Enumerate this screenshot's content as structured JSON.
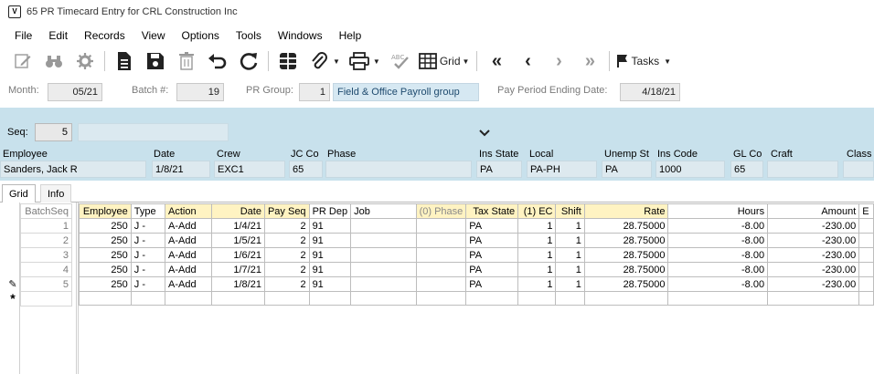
{
  "window": {
    "title": "65 PR Timecard Entry for CRL Construction Inc",
    "icon_glyph": "V"
  },
  "menu": [
    "File",
    "Edit",
    "Records",
    "View",
    "Options",
    "Tools",
    "Windows",
    "Help"
  ],
  "toolbar": {
    "grid_label": "Grid",
    "tasks_label": "Tasks",
    "icons": [
      "edit-icon",
      "binoculars-icon",
      "gear-icon",
      "document-icon",
      "save-icon",
      "trash-icon",
      "undo-icon",
      "refresh-icon",
      "grid-view-icon",
      "attachment-icon",
      "print-icon",
      "spellcheck-icon",
      "first-icon",
      "previous-icon",
      "next-icon",
      "last-icon",
      "flag-icon"
    ]
  },
  "filters": {
    "month_label": "Month:",
    "month_value": "05/21",
    "batch_label": "Batch #:",
    "batch_value": "19",
    "prgroup_label": "PR Group:",
    "prgroup_value": "1",
    "prgroup_desc": "Field & Office Payroll group",
    "ppe_label": "Pay Period Ending Date:",
    "ppe_value": "4/18/21"
  },
  "header": {
    "seq_label": "Seq:",
    "seq_value": "5",
    "fields": [
      {
        "label": "Employee",
        "value": "Sanders, Jack R"
      },
      {
        "label": "Date",
        "value": "1/8/21"
      },
      {
        "label": "Crew",
        "value": "EXC1"
      },
      {
        "label": "JC Co",
        "value": "65"
      },
      {
        "label": "Phase",
        "value": ""
      },
      {
        "label": "Ins State",
        "value": "PA"
      },
      {
        "label": "Local",
        "value": "PA-PH"
      },
      {
        "label": "Unemp St",
        "value": "PA"
      },
      {
        "label": "Ins Code",
        "value": "1000"
      },
      {
        "label": "GL Co",
        "value": "65"
      },
      {
        "label": "Craft",
        "value": ""
      },
      {
        "label": "Class",
        "value": ""
      }
    ]
  },
  "tabs": [
    "Grid",
    "Info"
  ],
  "seq_grid": {
    "header": "BatchSeq",
    "rows": [
      "1",
      "2",
      "3",
      "4",
      "5"
    ]
  },
  "grid": {
    "columns": [
      "Employee",
      "Type",
      "Action",
      "Date",
      "Pay Seq",
      "PR Dep",
      "Job",
      "(0) Phase",
      "Tax State",
      "(1) EC",
      "Shift",
      "Rate",
      "Hours",
      "Amount",
      "E"
    ],
    "rows": [
      [
        "250",
        "J -",
        "A-Add",
        "1/4/21",
        "2",
        "91",
        "",
        "",
        "PA",
        "1",
        "1",
        "28.75000",
        "-8.00",
        "-230.00",
        ""
      ],
      [
        "250",
        "J -",
        "A-Add",
        "1/5/21",
        "2",
        "91",
        "",
        "",
        "PA",
        "1",
        "1",
        "28.75000",
        "-8.00",
        "-230.00",
        ""
      ],
      [
        "250",
        "J -",
        "A-Add",
        "1/6/21",
        "2",
        "91",
        "",
        "",
        "PA",
        "1",
        "1",
        "28.75000",
        "-8.00",
        "-230.00",
        ""
      ],
      [
        "250",
        "J -",
        "A-Add",
        "1/7/21",
        "2",
        "91",
        "",
        "",
        "PA",
        "1",
        "1",
        "28.75000",
        "-8.00",
        "-230.00",
        ""
      ],
      [
        "250",
        "J -",
        "A-Add",
        "1/8/21",
        "2",
        "91",
        "",
        "",
        "PA",
        "1",
        "1",
        "28.75000",
        "-8.00",
        "-230.00",
        ""
      ]
    ]
  },
  "indicators": {
    "edit_glyph": "✎",
    "new_glyph": "*"
  }
}
